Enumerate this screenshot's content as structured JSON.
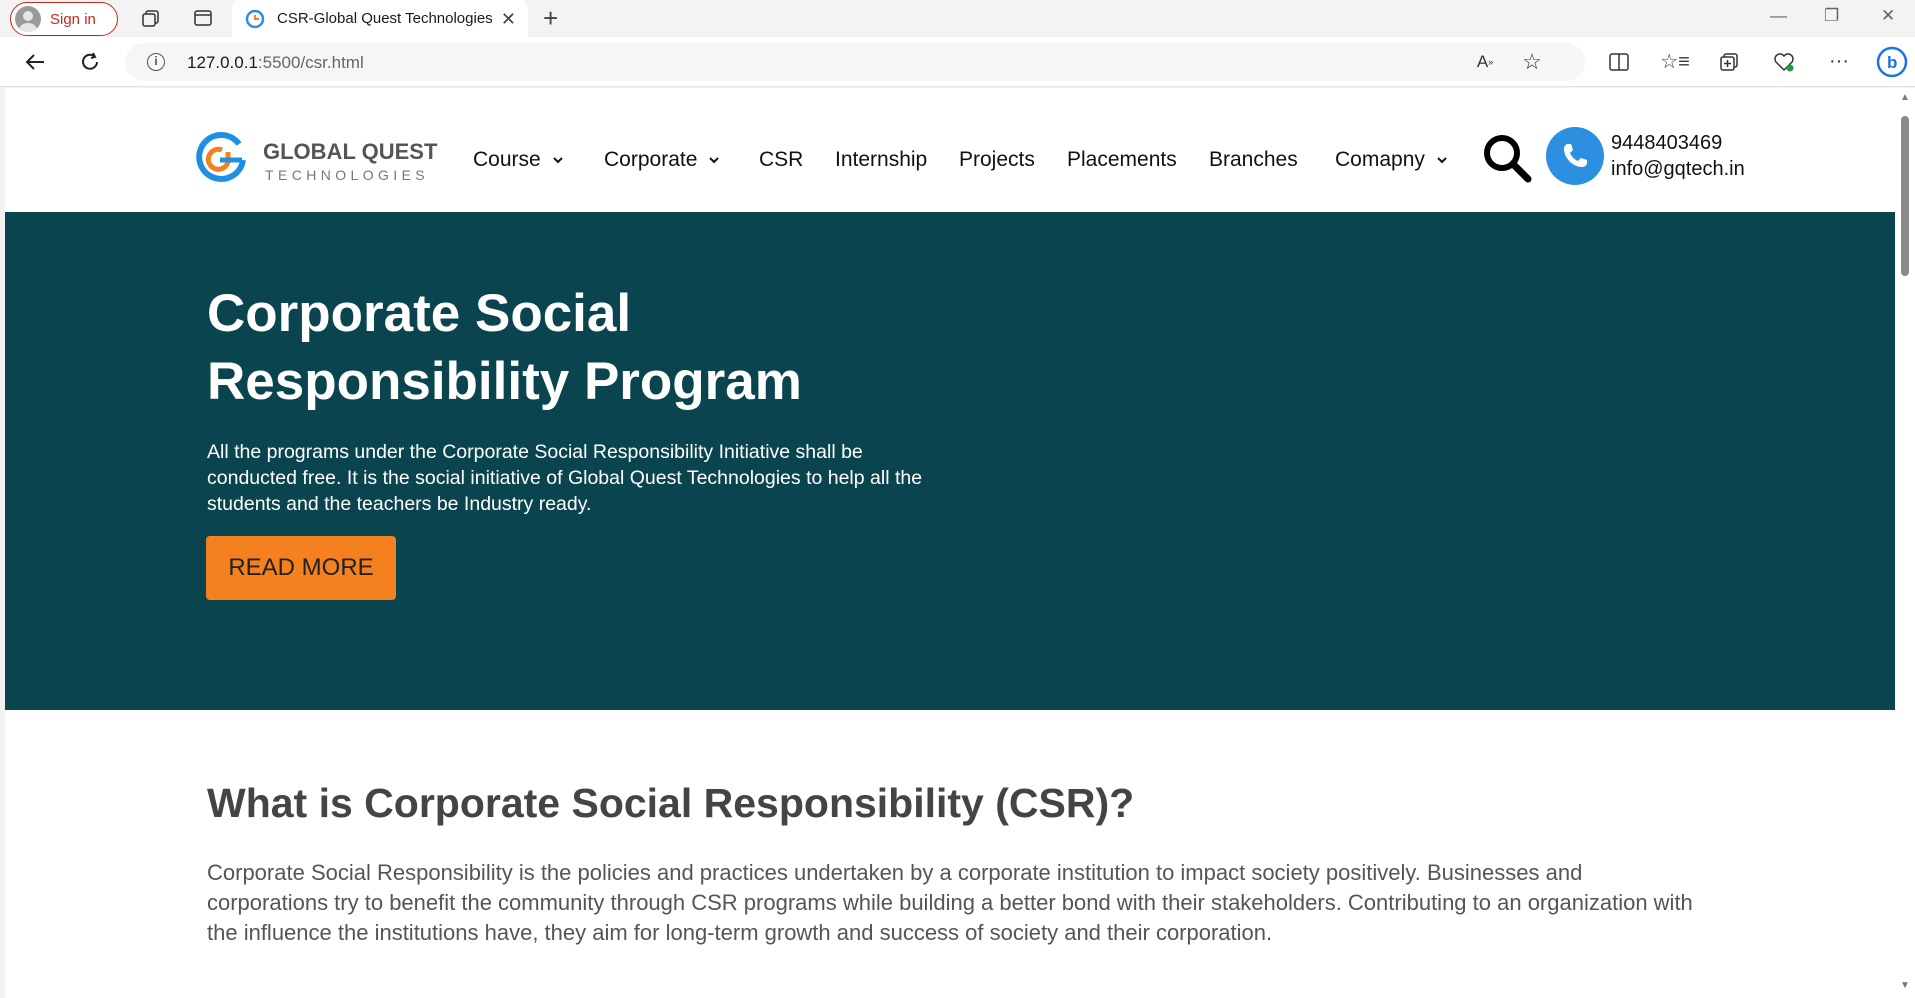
{
  "browser": {
    "signin_label": "Sign in",
    "tab_title": "CSR-Global Quest Technologies",
    "url_host": "127.0.0.1",
    "url_path": ":5500/csr.html"
  },
  "site": {
    "logo_line1": "GLOBAL QUEST",
    "logo_line2": "TECHNOLOGIES",
    "nav": [
      {
        "label": "Course",
        "dropdown": true
      },
      {
        "label": "Corporate",
        "dropdown": true
      },
      {
        "label": "CSR",
        "dropdown": false
      },
      {
        "label": "Internship",
        "dropdown": false
      },
      {
        "label": "Projects",
        "dropdown": false
      },
      {
        "label": "Placements",
        "dropdown": false
      },
      {
        "label": "Branches",
        "dropdown": false
      },
      {
        "label": "Comapny",
        "dropdown": true
      }
    ],
    "phone": "9448403469",
    "email": "info@gqtech.in"
  },
  "hero": {
    "title": "Corporate Social Responsibility Program",
    "description": "All the programs under the Corporate Social Responsibility Initiative shall be conducted free. It is the social initiative of Global Quest Technologies to help all the students and the teachers be Industry ready.",
    "button_label": "READ MORE"
  },
  "about": {
    "heading": "What is Corporate Social Responsibility (CSR)?",
    "body": "Corporate Social Responsibility is the policies and practices undertaken by a corporate institution to impact society positively. Businesses and corporations try to benefit the community through CSR programs while building a better bond with their stakeholders. Contributing to an organization with the influence the institutions have, they aim for long-term growth and success of society and their corporation."
  },
  "colors": {
    "hero_bg": "#0a454f",
    "button_bg": "#f4801f",
    "phone_accent": "#2d8fe0",
    "signin_accent": "#c42b1c"
  }
}
